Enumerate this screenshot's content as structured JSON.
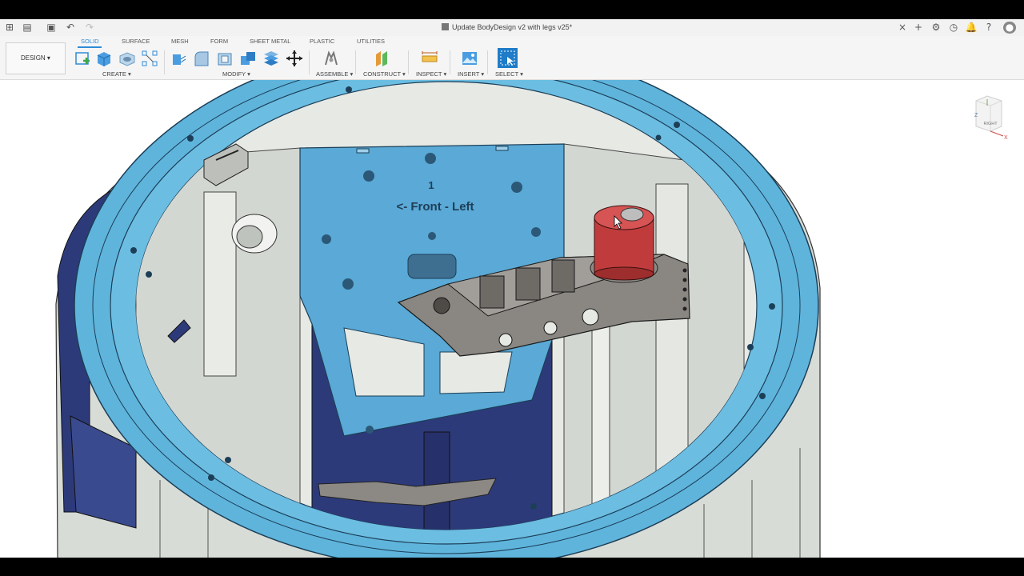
{
  "window": {
    "title": "Update BodyDesign v2 with legs v25*"
  },
  "workspace": {
    "label": "DESIGN"
  },
  "tabs": [
    {
      "label": "SOLID",
      "active": true
    },
    {
      "label": "SURFACE"
    },
    {
      "label": "MESH"
    },
    {
      "label": "FORM"
    },
    {
      "label": "SHEET METAL"
    },
    {
      "label": "PLASTIC"
    },
    {
      "label": "UTILITIES"
    }
  ],
  "groups": {
    "create": "CREATE",
    "modify": "MODIFY",
    "assemble": "ASSEMBLE",
    "construct": "CONSTRUCT",
    "inspect": "INSPECT",
    "insert": "INSERT",
    "select": "SELECT"
  },
  "model": {
    "plate_number": "1",
    "plate_text": "<- Front - Left"
  },
  "viewcube": {
    "face": "RIGHT",
    "axis_z": "Z",
    "axis_x": "X"
  },
  "colors": {
    "accent": "#2e8bd8",
    "ring_blue": "#5fb4dc",
    "plate_blue": "#5aa9d6",
    "navy": "#2d3a7a",
    "body_grey": "#d8dcd7",
    "bracket": "#8a8782",
    "red_cap": "#c03c3c"
  }
}
